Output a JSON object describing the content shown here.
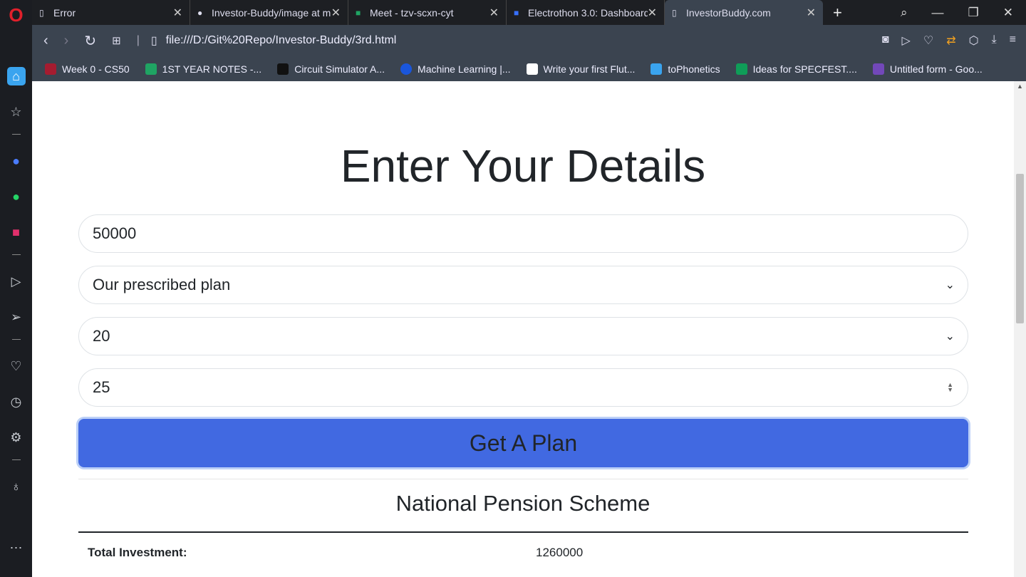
{
  "browser": {
    "tabs": [
      {
        "title": "Error",
        "active": false
      },
      {
        "title": "Investor-Buddy/image at m",
        "active": false
      },
      {
        "title": "Meet - tzv-scxn-cyt",
        "active": false
      },
      {
        "title": "Electrothon 3.0: Dashboard",
        "active": false
      },
      {
        "title": "InvestorBuddy.com",
        "active": true
      }
    ],
    "url": "file:///D:/Git%20Repo/Investor-Buddy/3rd.html",
    "bookmarks": [
      {
        "label": "Week 0 - CS50",
        "color": "#a51c30"
      },
      {
        "label": "1ST YEAR NOTES -...",
        "color": "#1fa463"
      },
      {
        "label": "Circuit Simulator A...",
        "color": "#111"
      },
      {
        "label": "Machine Learning |...",
        "color": "#1a56db"
      },
      {
        "label": "Write your first Flut...",
        "color": "#ffffff"
      },
      {
        "label": "toPhonetics",
        "color": "#3aa4ef"
      },
      {
        "label": "Ideas for SPECFEST....",
        "color": "#0f9d58"
      },
      {
        "label": "Untitled form - Goo...",
        "color": "#7248b9"
      }
    ]
  },
  "page": {
    "title": "Enter Your Details",
    "amount_value": "50000",
    "plan_select": "Our prescribed plan",
    "years_select": "20",
    "age_value": "25",
    "submit_label": "Get A Plan",
    "submit_color": "#4169e1",
    "scheme_title": "National Pension Scheme",
    "rows": [
      {
        "label": "Total Investment:",
        "value": "1260000"
      }
    ]
  }
}
